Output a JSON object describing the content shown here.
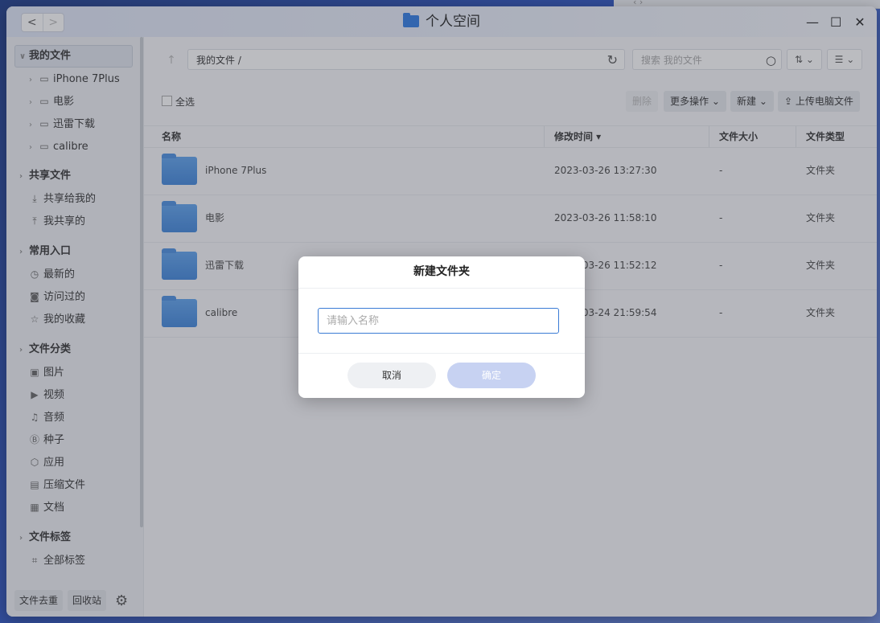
{
  "window": {
    "title": "个人空间",
    "nav_back": "<",
    "nav_forward": ">",
    "minimize": "—",
    "maximize": "☐",
    "close": "✕"
  },
  "sidebar": {
    "my_files": "我的文件",
    "folders": [
      "iPhone 7Plus",
      "电影",
      "迅雷下载",
      "calibre"
    ],
    "shared": {
      "heading": "共享文件",
      "items": [
        "共享给我的",
        "我共享的"
      ]
    },
    "quick": {
      "heading": "常用入口",
      "items": [
        "最新的",
        "访问过的",
        "我的收藏"
      ]
    },
    "categories": {
      "heading": "文件分类",
      "items": [
        "图片",
        "视频",
        "音频",
        "种子",
        "应用",
        "压缩文件",
        "文档"
      ]
    },
    "tags": {
      "heading": "文件标签",
      "items": [
        "全部标签"
      ]
    },
    "bottom": {
      "dedupe": "文件去重",
      "recycle": "回收站"
    }
  },
  "toolbar": {
    "path": "我的文件 /",
    "search_placeholder": "搜索 我的文件",
    "select_all": "全选",
    "delete": "删除",
    "more_actions": "更多操作 ⌄",
    "new": "新建 ⌄",
    "upload": "上传电脑文件"
  },
  "table": {
    "headers": {
      "name": "名称",
      "modified": "修改时间 ▾",
      "size": "文件大小",
      "type": "文件类型"
    },
    "rows": [
      {
        "name": "iPhone 7Plus",
        "modified": "2023-03-26 13:27:30",
        "size": "-",
        "type": "文件夹"
      },
      {
        "name": "电影",
        "modified": "2023-03-26 11:58:10",
        "size": "-",
        "type": "文件夹"
      },
      {
        "name": "迅雷下载",
        "modified": "2023-03-26 11:52:12",
        "size": "-",
        "type": "文件夹"
      },
      {
        "name": "calibre",
        "modified": "2023-03-24 21:59:54",
        "size": "-",
        "type": "文件夹"
      }
    ]
  },
  "dialog": {
    "title": "新建文件夹",
    "input_placeholder": "请输入名称",
    "input_value": "",
    "cancel": "取消",
    "confirm": "确定"
  }
}
